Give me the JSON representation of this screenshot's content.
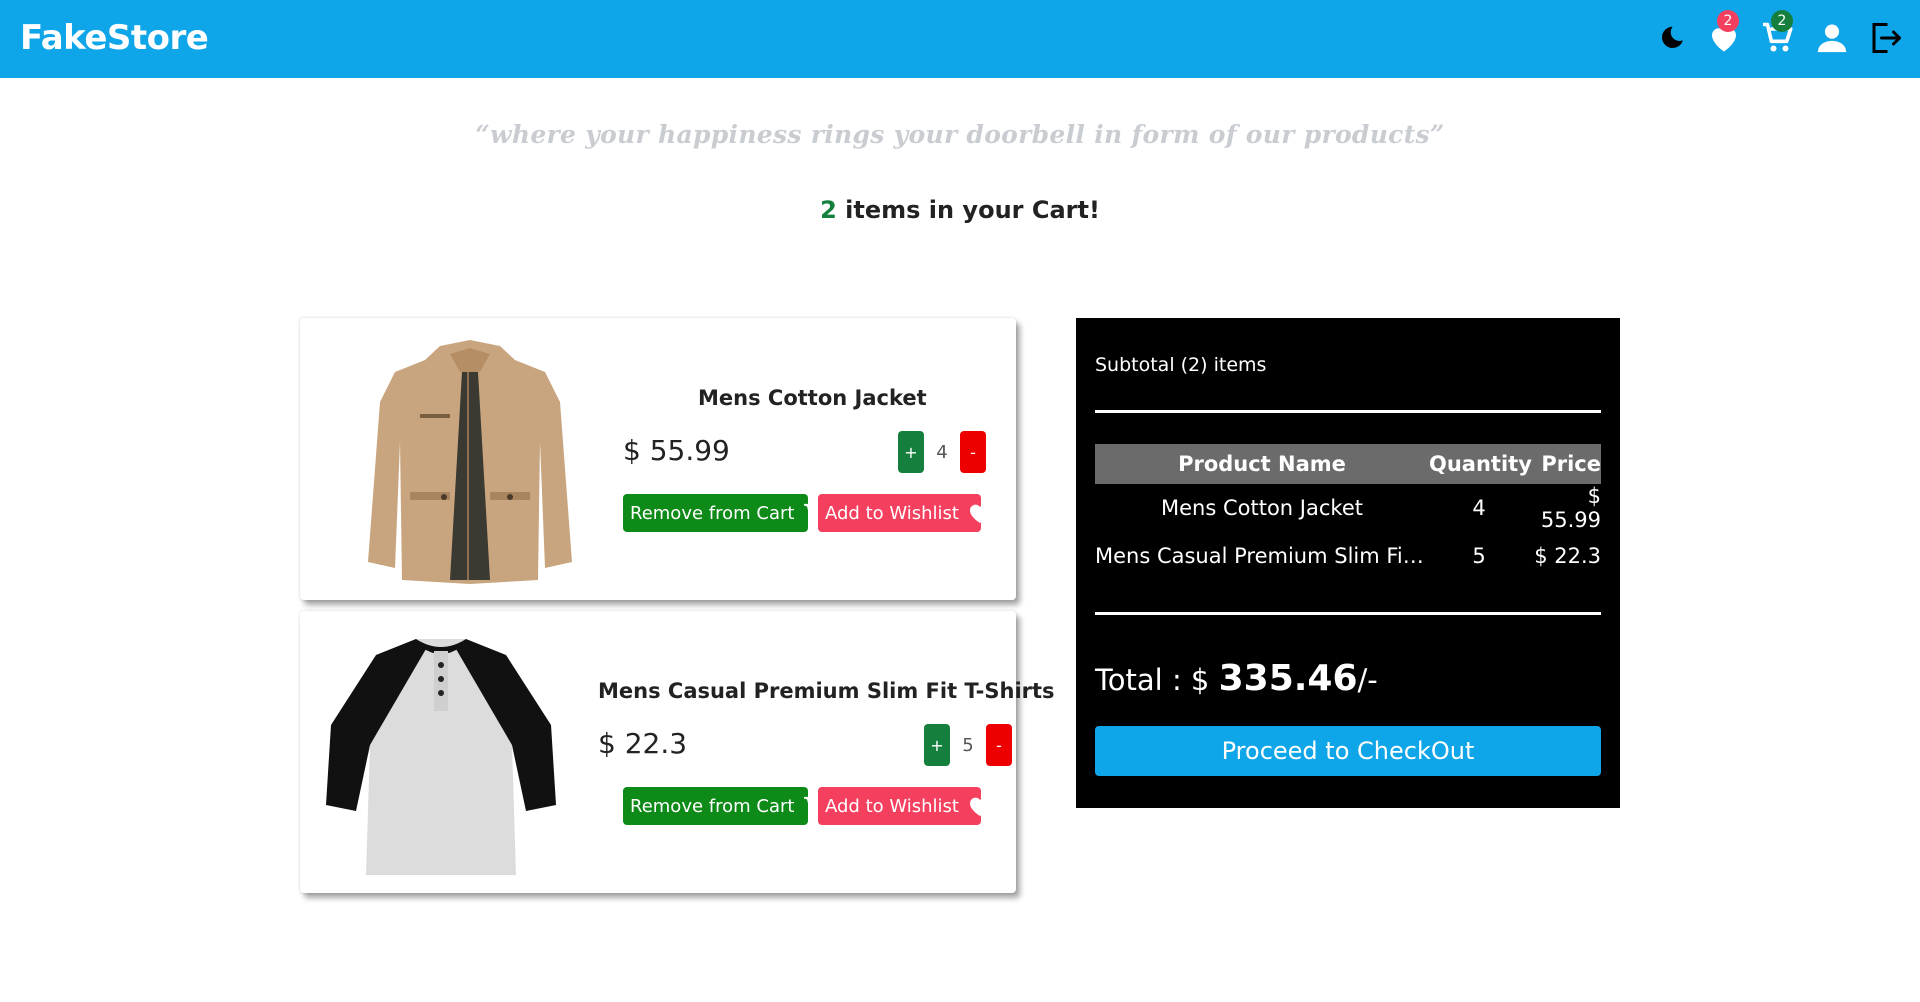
{
  "header": {
    "brand": "FakeStore",
    "bg_color": "#0ea5e9",
    "icons": [
      {
        "name": "moon-icon"
      },
      {
        "name": "heart-icon",
        "badge": "2",
        "badge_color": "#f43f5e"
      },
      {
        "name": "cart-icon",
        "badge": "2",
        "badge_color": "#15803d"
      },
      {
        "name": "user-icon"
      },
      {
        "name": "logout-icon"
      }
    ]
  },
  "tagline": "“where your happiness rings your doorbell in form of our products”",
  "cart_heading": {
    "count": "2",
    "text": " items in your Cart!"
  },
  "products": [
    {
      "name": "Mens Cotton Jacket",
      "price": "$ 55.99",
      "quantity": "4",
      "plus": "+",
      "minus": "-",
      "remove_label": "Remove from Cart",
      "wishlist_label": "Add to Wishlist"
    },
    {
      "name": "Mens Casual Premium Slim Fit T-Shirts",
      "price": "$ 22.3",
      "quantity": "5",
      "plus": "+",
      "minus": "-",
      "remove_label": "Remove from Cart",
      "wishlist_label": "Add to Wishlist"
    }
  ],
  "summary": {
    "subtotal": "Subtotal (2) items",
    "headers": [
      "Product Name",
      "Quantity",
      "Price"
    ],
    "rows": [
      {
        "name": "Mens Cotton Jacket",
        "qty": "4",
        "price": "$ 55.99"
      },
      {
        "name": "Mens Casual Premium Slim Fit...",
        "qty": "5",
        "price": "$ 22.3"
      }
    ],
    "total_label": "Total : $ ",
    "total_amount": "335.46",
    "total_suffix": "/-",
    "checkout_label": "Proceed to CheckOut"
  },
  "colors": {
    "accent": "#0ea5e9",
    "green": "#0d8a18",
    "red": "#ef0000",
    "pink": "#f43f5e"
  }
}
